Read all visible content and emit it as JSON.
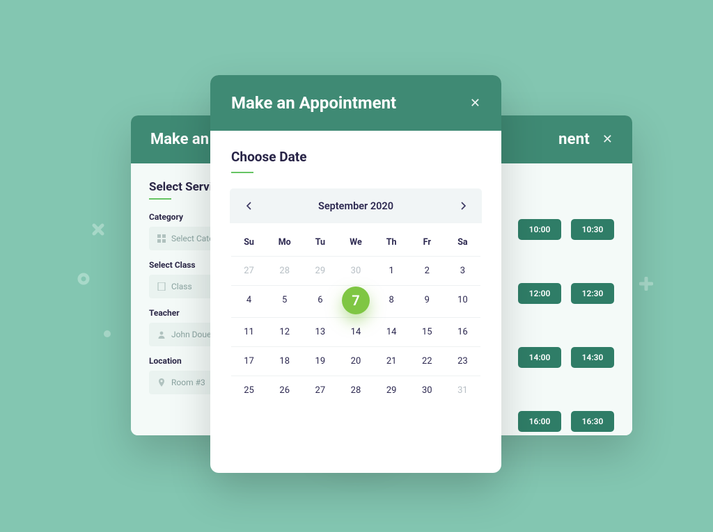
{
  "colors": {
    "bg": "#83c6b1",
    "accent": "#7fc643",
    "brand": "#3f8a74"
  },
  "leftCard": {
    "title": "Make an Appointment",
    "sectionTitle": "Select Service",
    "fields": {
      "categoryLabel": "Category",
      "categoryValue": "Select Category",
      "classLabel": "Select Class",
      "classValue": "Class",
      "teacherLabel": "Teacher",
      "teacherValue": "John Doue",
      "locationLabel": "Location",
      "locationValue": "Room #3"
    }
  },
  "rightCard": {
    "titlePartial": "nent",
    "times": [
      "10:00",
      "10:30",
      "12:00",
      "12:30",
      "14:00",
      "14:30",
      "16:00",
      "16:30"
    ]
  },
  "frontCard": {
    "title": "Make an Appointment",
    "sectionTitle": "Choose Date",
    "calendar": {
      "monthLabel": "September 2020",
      "weekdays": [
        "Su",
        "Mo",
        "Tu",
        "We",
        "Th",
        "Fr",
        "Sa"
      ],
      "selected": 7,
      "weeks": [
        [
          {
            "n": 27,
            "muted": true
          },
          {
            "n": 28,
            "muted": true
          },
          {
            "n": 29,
            "muted": true
          },
          {
            "n": 30,
            "muted": true
          },
          {
            "n": 1
          },
          {
            "n": 2
          },
          {
            "n": 3
          }
        ],
        [
          {
            "n": 4
          },
          {
            "n": 5
          },
          {
            "n": 6
          },
          {
            "n": 7,
            "sel": true
          },
          {
            "n": 8
          },
          {
            "n": 9
          },
          {
            "n": 10
          }
        ],
        [
          {
            "n": 11
          },
          {
            "n": 12
          },
          {
            "n": 13
          },
          {
            "n": 14
          },
          {
            "n": 14
          },
          {
            "n": 15
          },
          {
            "n": 16
          }
        ],
        [
          {
            "n": 17
          },
          {
            "n": 18
          },
          {
            "n": 19
          },
          {
            "n": 20
          },
          {
            "n": 21
          },
          {
            "n": 22
          },
          {
            "n": 23
          }
        ],
        [
          {
            "n": 25
          },
          {
            "n": 26
          },
          {
            "n": 27
          },
          {
            "n": 28
          },
          {
            "n": 29
          },
          {
            "n": 30
          },
          {
            "n": 31,
            "muted": true
          }
        ]
      ]
    }
  }
}
